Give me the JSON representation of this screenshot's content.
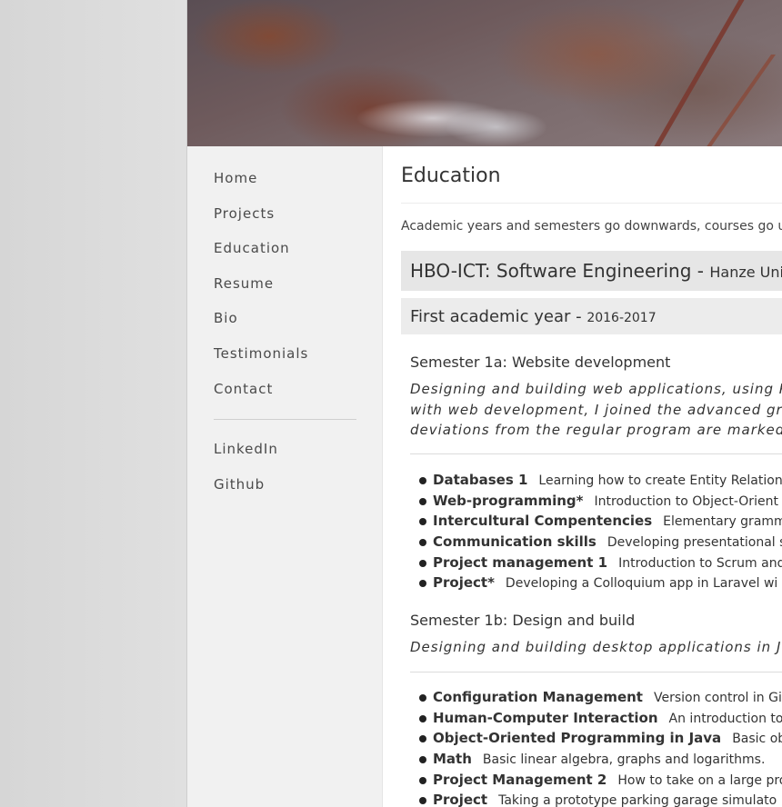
{
  "nav": {
    "items": [
      "Home",
      "Projects",
      "Education",
      "Resume",
      "Bio",
      "Testimonials",
      "Contact"
    ],
    "external": [
      "LinkedIn",
      "Github"
    ]
  },
  "page": {
    "title": "Education",
    "intro": "Academic years and semesters go downwards, courses go upt"
  },
  "program": {
    "name": "HBO-ICT: Software Engineering - ",
    "institution": "Hanze Univer"
  },
  "year": {
    "name": "First academic year - ",
    "range": "2016-2017"
  },
  "semesters": [
    {
      "title": "Semester 1a: Website development",
      "desc": [
        "Designing and building web applications, using PHP",
        "with web development, I joined the advanced group",
        "deviations from the regular program are marked by"
      ],
      "courses": [
        {
          "name": "Databases 1",
          "desc": "Learning how to create Entity Relationa"
        },
        {
          "name": "Web-programming*",
          "desc": "Introduction to Object-Orient"
        },
        {
          "name": "Intercultural Compentencies",
          "desc": "Elementary gramma"
        },
        {
          "name": "Communication skills",
          "desc": "Developing presentational s"
        },
        {
          "name": "Project management 1",
          "desc": "Introduction to Scrum and"
        },
        {
          "name": "Project*",
          "desc": "Developing a Colloquium app in Laravel wi"
        }
      ]
    },
    {
      "title": "Semester 1b: Design and build",
      "desc": [
        "Designing and building desktop applications in Java"
      ],
      "courses": [
        {
          "name": "Configuration Management",
          "desc": "Version control in Git"
        },
        {
          "name": "Human-Computer Interaction",
          "desc": "An introduction to"
        },
        {
          "name": "Object-Oriented Programming in Java",
          "desc": "Basic obje"
        },
        {
          "name": "Math",
          "desc": "Basic linear algebra, graphs and logarithms."
        },
        {
          "name": "Project Management 2",
          "desc": "How to take on a large pro"
        },
        {
          "name": "Project",
          "desc": "Taking a prototype parking garage simulato"
        }
      ]
    }
  ]
}
